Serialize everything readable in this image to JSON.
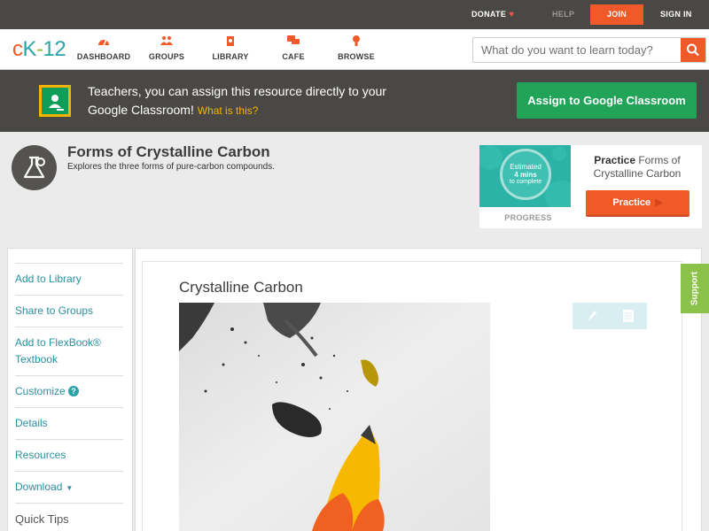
{
  "topbar": {
    "donate": "DONATE",
    "help": "HELP",
    "join": "JOIN",
    "signin": "SIGN IN"
  },
  "nav": {
    "logo": {
      "c": "c",
      "k": "K",
      "dash": "-",
      "num": "12"
    },
    "items": [
      {
        "label": "DASHBOARD",
        "icon": "dashboard-icon"
      },
      {
        "label": "GROUPS",
        "icon": "groups-icon"
      },
      {
        "label": "LIBRARY",
        "icon": "library-icon"
      },
      {
        "label": "CAFE",
        "icon": "cafe-icon"
      },
      {
        "label": "BROWSE",
        "icon": "browse-icon"
      }
    ],
    "search_placeholder": "What do you want to learn today?"
  },
  "banner": {
    "text": "Teachers, you can assign this resource directly to your Google Classroom!",
    "link": "What is this?",
    "assign_button": "Assign to Google Classroom"
  },
  "concept": {
    "title": "Forms of Crystalline Carbon",
    "subtitle": "Explores the three forms of pure-carbon compounds."
  },
  "practice": {
    "estimate_line1": "Estimated",
    "estimate_line2": "4 mins",
    "estimate_line3": "to complete",
    "progress_label": "PROGRESS",
    "title_bold": "Practice",
    "title_rest": "Forms of Crystalline Carbon",
    "button": "Practice"
  },
  "sidebar": {
    "items": [
      {
        "label": "Add to Library"
      },
      {
        "label": "Share to Groups"
      },
      {
        "label": "Add to FlexBook® Textbook"
      },
      {
        "label": "Customize"
      },
      {
        "label": "Details"
      },
      {
        "label": "Resources"
      },
      {
        "label": "Download"
      }
    ],
    "quick_tips": "Quick Tips"
  },
  "content": {
    "title": "Crystalline Carbon"
  },
  "support": "Support",
  "colors": {
    "accent": "#f05a28",
    "topbar": "#4a4845",
    "classroom_green": "#21a358",
    "link": "#2a8fa0",
    "support": "#8bc34a"
  }
}
